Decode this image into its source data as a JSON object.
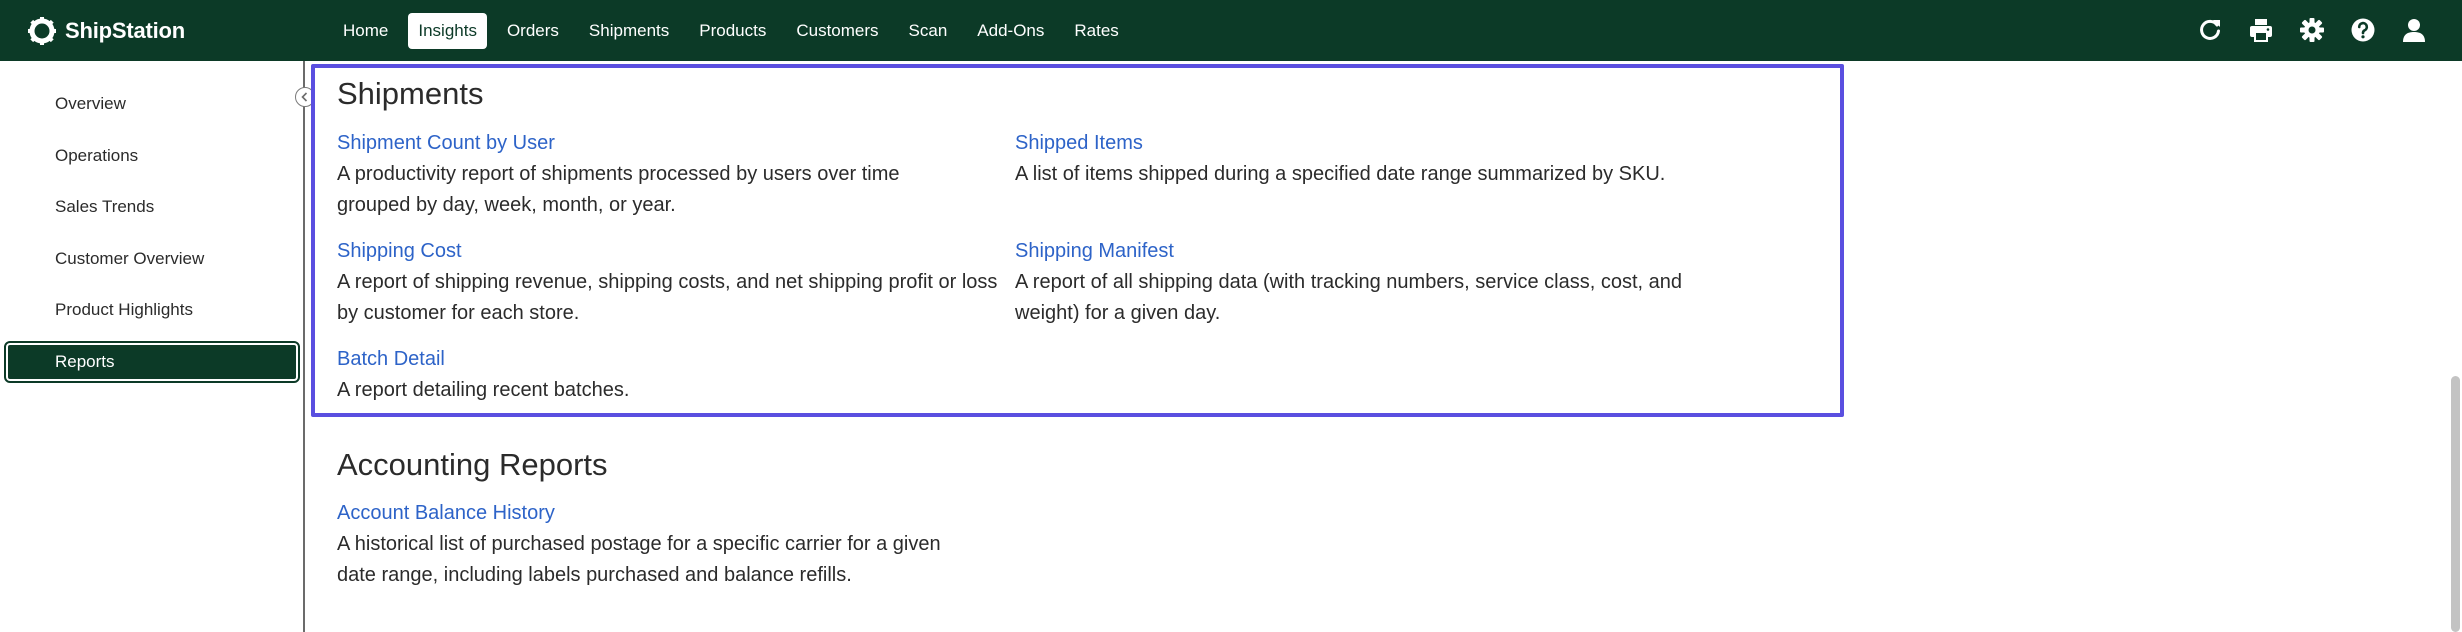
{
  "app": {
    "name": "ShipStation"
  },
  "nav": {
    "items": [
      {
        "label": "Home"
      },
      {
        "label": "Insights",
        "active": true
      },
      {
        "label": "Orders"
      },
      {
        "label": "Shipments"
      },
      {
        "label": "Products"
      },
      {
        "label": "Customers"
      },
      {
        "label": "Scan"
      },
      {
        "label": "Add-Ons"
      },
      {
        "label": "Rates"
      }
    ]
  },
  "toolbar_icons": [
    "refresh-icon",
    "print-icon",
    "gear-icon",
    "help-icon",
    "user-icon"
  ],
  "sidebar": {
    "items": [
      {
        "label": "Overview"
      },
      {
        "label": "Operations"
      },
      {
        "label": "Sales Trends"
      },
      {
        "label": "Customer Overview"
      },
      {
        "label": "Product Highlights"
      },
      {
        "label": "Reports",
        "active": true
      }
    ]
  },
  "sections": {
    "shipments": {
      "title": "Shipments",
      "reports": [
        {
          "title": "Shipment Count by User",
          "description": "A productivity report of shipments processed by users over time grouped by day, week, month, or year."
        },
        {
          "title": "Shipped Items",
          "description": "A list of items shipped during a specified date range summarized by SKU."
        },
        {
          "title": "Shipping Cost",
          "description": "A report of shipping revenue, shipping costs, and net shipping profit or loss by customer for each store."
        },
        {
          "title": "Shipping Manifest",
          "description": "A report of all shipping data (with tracking numbers, service class, cost, and weight) for a given day."
        },
        {
          "title": "Batch Detail",
          "description": "A report detailing recent batches."
        }
      ]
    },
    "accounting": {
      "title": "Accounting Reports",
      "reports": [
        {
          "title": "Account Balance History",
          "description": "A historical list of purchased postage for a specific carrier for a given date range, including labels purchased and balance refills."
        }
      ]
    }
  },
  "colors": {
    "brand": "#0c3a27",
    "link": "#2d63c8",
    "focus": "#5a4fe0"
  }
}
